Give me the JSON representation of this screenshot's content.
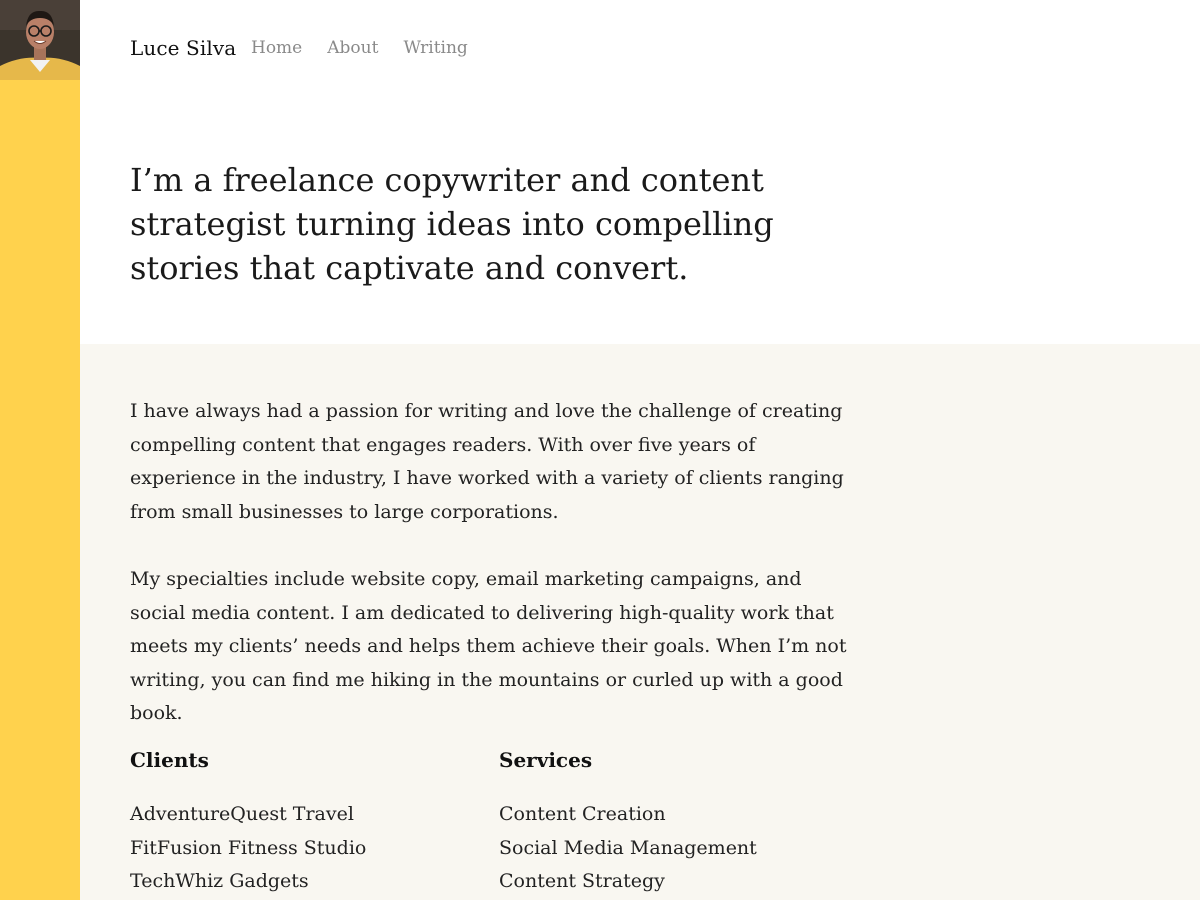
{
  "colors": {
    "rail": "#ffd24d",
    "content_bg": "#f9f7f1",
    "nav_text": "#8a8a8a"
  },
  "avatar": {
    "icon": "profile-photo"
  },
  "header": {
    "brand": "Luce Silva",
    "nav": [
      {
        "label": "Home"
      },
      {
        "label": "About"
      },
      {
        "label": "Writing"
      }
    ]
  },
  "hero": {
    "headline": "I’m a freelance copywriter and content strategist turning ideas into compelling stories that captivate and convert."
  },
  "about": {
    "paragraph1": "I have always had a passion for writing and love the challenge of creating compelling content that engages readers. With over five years of experience in the industry, I have worked with a variety of clients ranging from small businesses to large corporations.",
    "paragraph2": "My specialties include website copy, email marketing campaigns, and social media content. I am dedicated to delivering high-quality work that meets my clients’ needs and helps them achieve their goals. When I’m not writing, you can find me hiking in the mountains or curled up with a good book."
  },
  "clients": {
    "heading": "Clients",
    "items": [
      "AdventureQuest Travel",
      "FitFusion Fitness Studio",
      "TechWhiz Gadgets"
    ]
  },
  "services": {
    "heading": "Services",
    "items": [
      "Content Creation",
      "Social Media Management",
      "Content Strategy"
    ]
  }
}
